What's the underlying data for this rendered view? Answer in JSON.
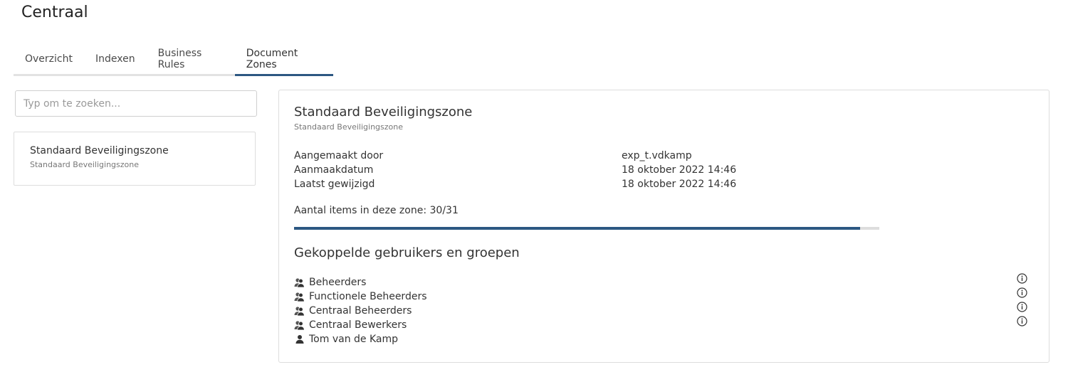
{
  "page": {
    "title": "Centraal"
  },
  "tabs": [
    {
      "label": "Overzicht",
      "active": false
    },
    {
      "label": "Indexen",
      "active": false
    },
    {
      "label": "Business Rules",
      "active": false
    },
    {
      "label": "Document Zones",
      "active": true
    }
  ],
  "search": {
    "placeholder": "Typ om te zoeken...",
    "value": ""
  },
  "zone_list": [
    {
      "title": "Standaard Beveiligingszone",
      "subtitle": "Standaard Beveiligingszone"
    }
  ],
  "detail": {
    "title": "Standaard Beveiligingszone",
    "subtitle": "Standaard Beveiligingszone",
    "meta": [
      {
        "label": "Aangemaakt door",
        "value": "exp_t.vdkamp"
      },
      {
        "label": "Aanmaakdatum",
        "value": "18 oktober 2022 14:46"
      },
      {
        "label": "Laatst gewijzigd",
        "value": "18 oktober 2022 14:46"
      }
    ],
    "count_text": "Aantal items in deze zone: 30/31",
    "progress_fraction": 0.9677,
    "colors": {
      "accent": "#2c5882",
      "track": "#dddddd"
    },
    "linked_title": "Gekoppelde gebruikers en groepen",
    "linked": [
      {
        "name": "Beheerders",
        "icon": "group-icon",
        "info": true
      },
      {
        "name": "Functionele Beheerders",
        "icon": "group-icon",
        "info": true
      },
      {
        "name": "Centraal Beheerders",
        "icon": "group-icon",
        "info": true
      },
      {
        "name": "Centraal Bewerkers",
        "icon": "group-icon",
        "info": true
      },
      {
        "name": "Tom van de Kamp",
        "icon": "user-icon",
        "info": false
      }
    ]
  }
}
